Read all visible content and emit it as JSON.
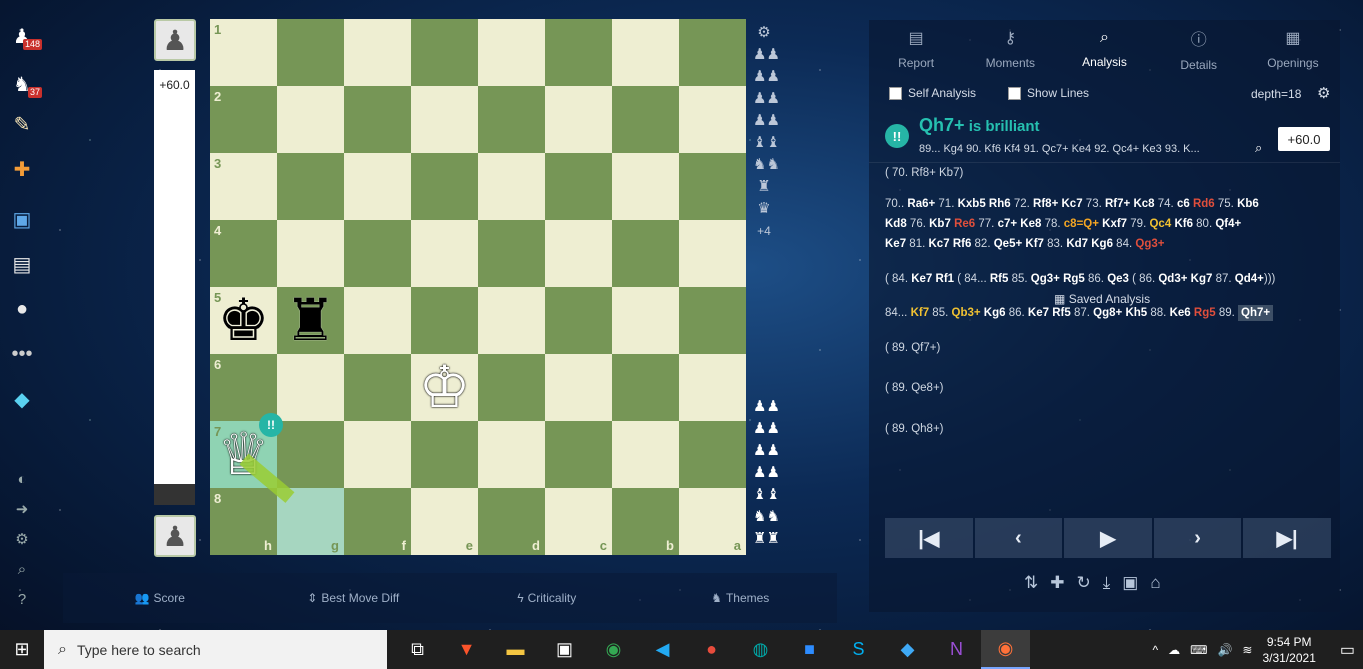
{
  "sidebar": {
    "items": [
      {
        "icon": "pawn-icon",
        "badge": "148"
      },
      {
        "icon": "puzzle-icon",
        "badge": "37"
      },
      {
        "icon": "lesson-icon",
        "badge": ""
      },
      {
        "icon": "tools-icon",
        "badge": ""
      },
      {
        "icon": "school-icon",
        "badge": ""
      },
      {
        "icon": "news-icon",
        "badge": ""
      },
      {
        "icon": "chat-icon",
        "badge": ""
      },
      {
        "icon": "more-icon",
        "badge": ""
      },
      {
        "icon": "diamond-icon",
        "badge": ""
      }
    ],
    "bottom": [
      "theme-icon",
      "signin-icon",
      "settings-icon",
      "search-icon",
      "help-icon"
    ]
  },
  "eval_bar": {
    "value": "+60.0"
  },
  "board": {
    "ranks": [
      "1",
      "2",
      "3",
      "4",
      "5",
      "6",
      "7",
      "8"
    ],
    "files": [
      "h",
      "g",
      "f",
      "e",
      "d",
      "c",
      "b",
      "a"
    ],
    "pieces": [
      {
        "square": "r5c0",
        "glyph": "♚",
        "color": "black",
        "name": "black-king"
      },
      {
        "square": "r5c1",
        "glyph": "♜",
        "color": "black",
        "name": "black-rook"
      },
      {
        "square": "r6c3",
        "glyph": "♔",
        "color": "white",
        "name": "white-king"
      },
      {
        "square": "r7c0",
        "glyph": "♕",
        "color": "white",
        "name": "white-queen"
      }
    ],
    "brilliant_badge": "!!"
  },
  "captured_top_count": "+4",
  "bottom_bar": {
    "items": [
      {
        "label": "Score",
        "icon": "people-icon"
      },
      {
        "label": "Best Move Diff",
        "icon": "updown-icon"
      },
      {
        "label": "Criticality",
        "icon": "bolt-icon"
      },
      {
        "label": "Themes",
        "icon": "themes-icon"
      }
    ]
  },
  "panel": {
    "tabs": [
      {
        "label": "Report",
        "icon": "report-icon"
      },
      {
        "label": "Moments",
        "icon": "key-icon"
      },
      {
        "label": "Analysis",
        "icon": "analysis-icon"
      },
      {
        "label": "Details",
        "icon": "info-icon"
      },
      {
        "label": "Openings",
        "icon": "book-icon"
      }
    ],
    "self_analysis": "Self Analysis",
    "show_lines": "Show Lines",
    "depth": "depth=18",
    "headline": {
      "badge": "!!",
      "move": "Qh7+",
      "verdict": " is brilliant",
      "line": "89... Kg4 90. Kf6 Kf4 91. Qc7+ Ke4 92. Qc4+ Ke3 93. K...",
      "eval": "+60.0"
    },
    "lines": {
      "l0": "( 70. Rf8+ Kb7)",
      "l5": "( 89. Qf7+)",
      "l6": "( 89. Qe8+)",
      "l7": "( 89. Qh8+)"
    },
    "saved_analysis": "Saved Analysis"
  },
  "taskbar": {
    "search_placeholder": "Type here to search",
    "time": "9:54 PM",
    "date": "3/31/2021"
  }
}
